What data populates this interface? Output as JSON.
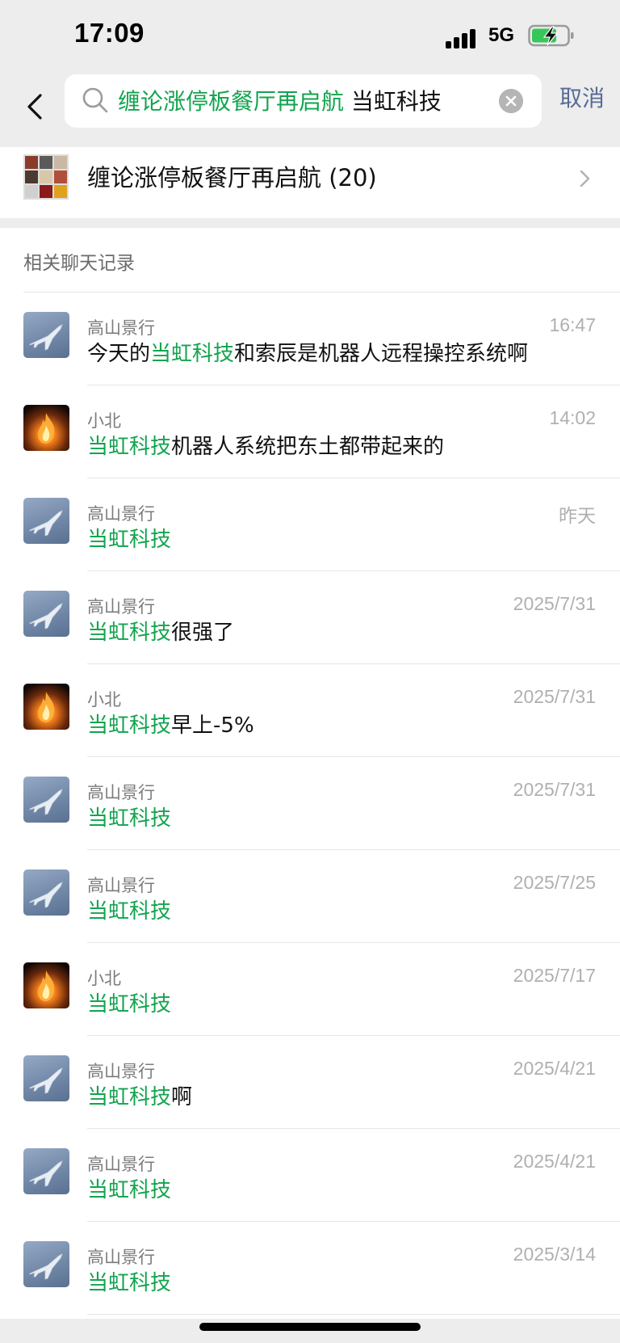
{
  "status": {
    "time": "17:09",
    "network": "5G"
  },
  "search": {
    "query_highlight": "缠论涨停板餐厅再启航",
    "query_rest": "当虹科技",
    "cancel_label": "取消"
  },
  "group": {
    "name": "缠论涨停板餐厅再启航 (20)"
  },
  "section_title": "相关聊天记录",
  "colors": {
    "highlight": "#12a44e",
    "link": "#576b95"
  },
  "messages": [
    {
      "sender": "高山景行",
      "time": "16:47",
      "avatar": "plane-avatar",
      "prefix": "今天的",
      "highlight": "当虹科技",
      "suffix": "和索辰是机器人远程操控系统啊"
    },
    {
      "sender": "小北",
      "time": "14:02",
      "avatar": "fire-avatar",
      "prefix": "",
      "highlight": "当虹科技",
      "suffix": "机器人系统把东土都带起来的"
    },
    {
      "sender": "高山景行",
      "time": "昨天",
      "avatar": "plane-avatar",
      "prefix": "",
      "highlight": "当虹科技",
      "suffix": ""
    },
    {
      "sender": "高山景行",
      "time": "2025/7/31",
      "avatar": "plane-avatar",
      "prefix": "",
      "highlight": "当虹科技",
      "suffix": "很强了"
    },
    {
      "sender": "小北",
      "time": "2025/7/31",
      "avatar": "fire-avatar",
      "prefix": "",
      "highlight": "当虹科技",
      "suffix": "早上-5%"
    },
    {
      "sender": "高山景行",
      "time": "2025/7/31",
      "avatar": "plane-avatar",
      "prefix": "",
      "highlight": "当虹科技",
      "suffix": ""
    },
    {
      "sender": "高山景行",
      "time": "2025/7/25",
      "avatar": "plane-avatar",
      "prefix": "",
      "highlight": "当虹科技",
      "suffix": ""
    },
    {
      "sender": "小北",
      "time": "2025/7/17",
      "avatar": "fire-avatar",
      "prefix": "",
      "highlight": "当虹科技",
      "suffix": ""
    },
    {
      "sender": "高山景行",
      "time": "2025/4/21",
      "avatar": "plane-avatar",
      "prefix": "",
      "highlight": "当虹科技",
      "suffix": "啊"
    },
    {
      "sender": "高山景行",
      "time": "2025/4/21",
      "avatar": "plane-avatar",
      "prefix": "",
      "highlight": "当虹科技",
      "suffix": ""
    },
    {
      "sender": "高山景行",
      "time": "2025/3/14",
      "avatar": "plane-avatar",
      "prefix": "",
      "highlight": "当虹科技",
      "suffix": ""
    }
  ]
}
